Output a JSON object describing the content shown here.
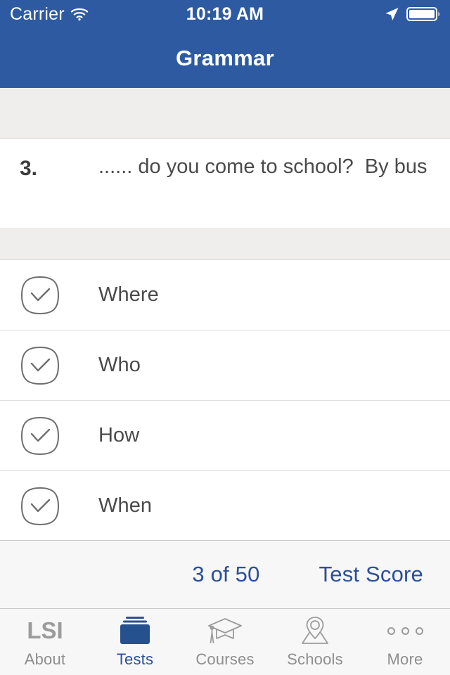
{
  "status_bar": {
    "carrier": "Carrier",
    "time": "10:19 AM",
    "wifi_icon": "wifi-icon",
    "location_icon": "location-arrow-icon",
    "battery_icon": "battery-icon"
  },
  "nav_bar": {
    "title": "Grammar"
  },
  "question": {
    "number": "3.",
    "text": "...... do you come to school?  By bus"
  },
  "options": [
    {
      "label": "Where",
      "icon": "checkbox-unselected-icon"
    },
    {
      "label": "Who",
      "icon": "checkbox-unselected-icon"
    },
    {
      "label": "How",
      "icon": "checkbox-unselected-icon"
    },
    {
      "label": "When",
      "icon": "checkbox-unselected-icon"
    }
  ],
  "toolbar": {
    "progress": "3 of 50",
    "score_label": "Test Score"
  },
  "tab_bar": {
    "items": [
      {
        "label": "About",
        "icon": "lsi-logo-icon",
        "logo_text": "LSI",
        "selected": false
      },
      {
        "label": "Tests",
        "icon": "books-stack-icon",
        "selected": true
      },
      {
        "label": "Courses",
        "icon": "graduation-cap-icon",
        "selected": false
      },
      {
        "label": "Schools",
        "icon": "map-pin-icon",
        "selected": false
      },
      {
        "label": "More",
        "icon": "ellipsis-icon",
        "selected": false
      }
    ]
  },
  "colors": {
    "brand_blue": "#2E5AA2",
    "link_blue": "#2B5099",
    "band_gray": "#EFEEEC",
    "text_gray": "#4A4A4A",
    "icon_gray": "#9B9B9B"
  }
}
